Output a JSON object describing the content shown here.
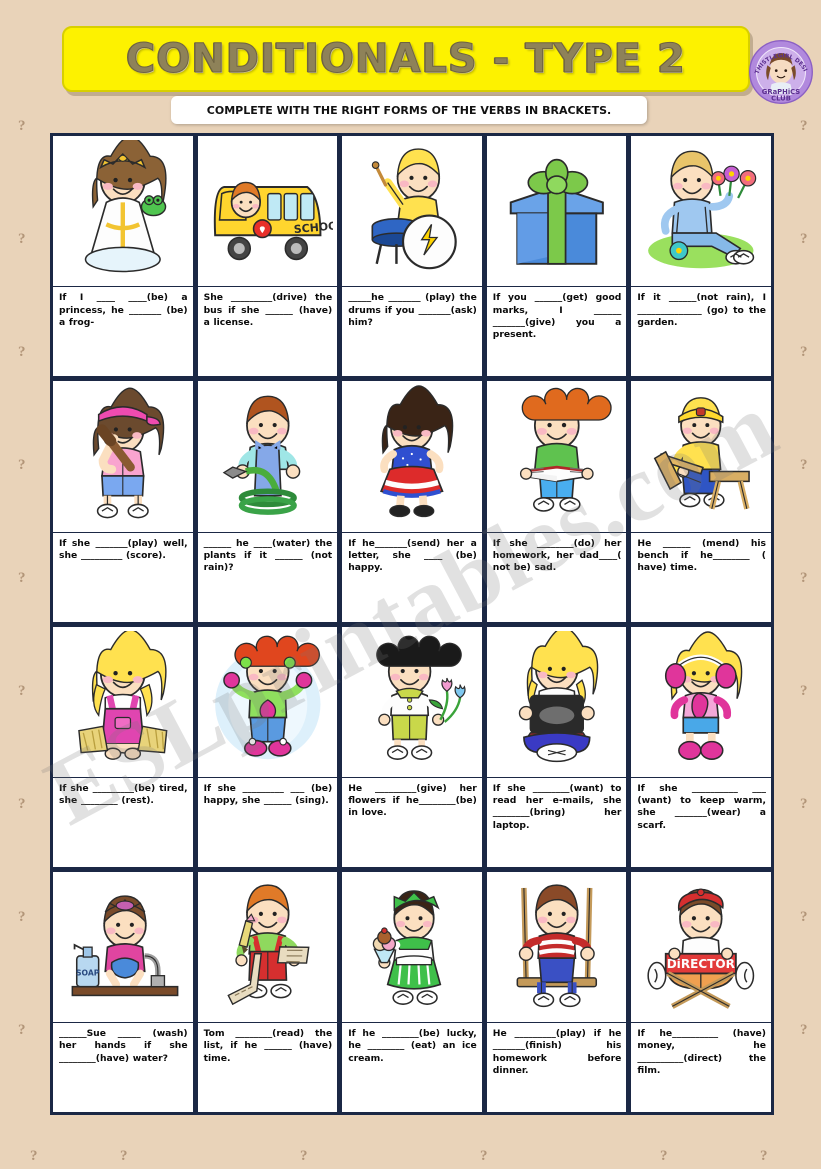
{
  "page": {
    "background_color": "#e9d3b9",
    "watermark_text": "ESLprintables.com",
    "decor_glyph": "?"
  },
  "header": {
    "title": "CONDITIONALS - TYPE 2",
    "title_bg_color": "#fdf200",
    "instruction": "COMPLETE WITH THE RIGHT FORMS OF THE VERBS IN BRACKETS."
  },
  "logo": {
    "top_arc_text": "THISTLEGIRL DESIGNS",
    "line1": "GRaPHiCS",
    "line2": "CLUB",
    "color": "#a87fd4"
  },
  "grid": {
    "columns": 5,
    "rows": 4,
    "border_color": "#1b2845",
    "items": [
      {
        "id": 1,
        "icon": "princess-with-frog-icon",
        "text": "If I ____ ____(be) a princess, he _______ (be) a frog-"
      },
      {
        "id": 2,
        "icon": "school-bus-icon",
        "text": "She _________(drive) the bus if she ______ (have) a license."
      },
      {
        "id": 3,
        "icon": "boy-playing-drums-icon",
        "text": "_____he _______ (play) the drums if you _______(ask) him?"
      },
      {
        "id": 4,
        "icon": "gift-box-icon",
        "text": "If you ______(get) good marks, I ______ _______(give) you a present."
      },
      {
        "id": 5,
        "icon": "boy-with-flowers-icon",
        "text": "If it ______(not rain), I ______________ (go) to the garden."
      },
      {
        "id": 6,
        "icon": "girl-with-baseball-bat-icon",
        "text": "If she _______(play) well, she _________ (score)."
      },
      {
        "id": 7,
        "icon": "boy-with-garden-hose-icon",
        "text": "______ he ____(water) the plants if it ______ (not rain)?"
      },
      {
        "id": 8,
        "icon": "girl-in-red-dress-icon",
        "text": "If he_______(send) her a letter, she ____ (be) happy."
      },
      {
        "id": 9,
        "icon": "girl-reading-book-icon",
        "text": "If she ________(do) her homework, her dad____( not be) sad."
      },
      {
        "id": 10,
        "icon": "girl-sawing-wood-icon",
        "text": "He ______ (mend) his bench if he________ ( have) time."
      },
      {
        "id": 11,
        "icon": "girl-sitting-on-hay-icon",
        "text": "If she _________(be) tired, she ________ (rest)."
      },
      {
        "id": 12,
        "icon": "girl-making-snow-angel-icon",
        "text": "If she _________ ___ (be) happy, she ______ (sing)."
      },
      {
        "id": 13,
        "icon": "boy-holding-tulips-icon",
        "text": "He _________(give) her flowers if he________(be) in love."
      },
      {
        "id": 14,
        "icon": "girl-with-laptop-icon",
        "text": "If she ________(want) to read her e-mails, she ________(bring) her laptop."
      },
      {
        "id": 15,
        "icon": "girl-with-earmuffs-icon",
        "text": "If she __________ ___ (want) to keep warm, she _______(wear) a scarf."
      },
      {
        "id": 16,
        "icon": "girl-washing-hands-icon",
        "text": "______Sue _____ (wash) her hands if she ________(have) water?"
      },
      {
        "id": 17,
        "icon": "boy-with-shopping-list-icon",
        "text": "Tom ________(read) the list, if he ______ (have) time."
      },
      {
        "id": 18,
        "icon": "girl-with-ice-cream-icon",
        "text": "If he ________(be) lucky, he ________ (eat) an ice cream."
      },
      {
        "id": 19,
        "icon": "boy-on-swing-icon",
        "text": "He _________(play) if he _______(finish) his homework before dinner."
      },
      {
        "id": 20,
        "icon": "boy-director-chair-icon",
        "text": "If he__________ (have) money, he __________(direct) the film."
      }
    ]
  }
}
